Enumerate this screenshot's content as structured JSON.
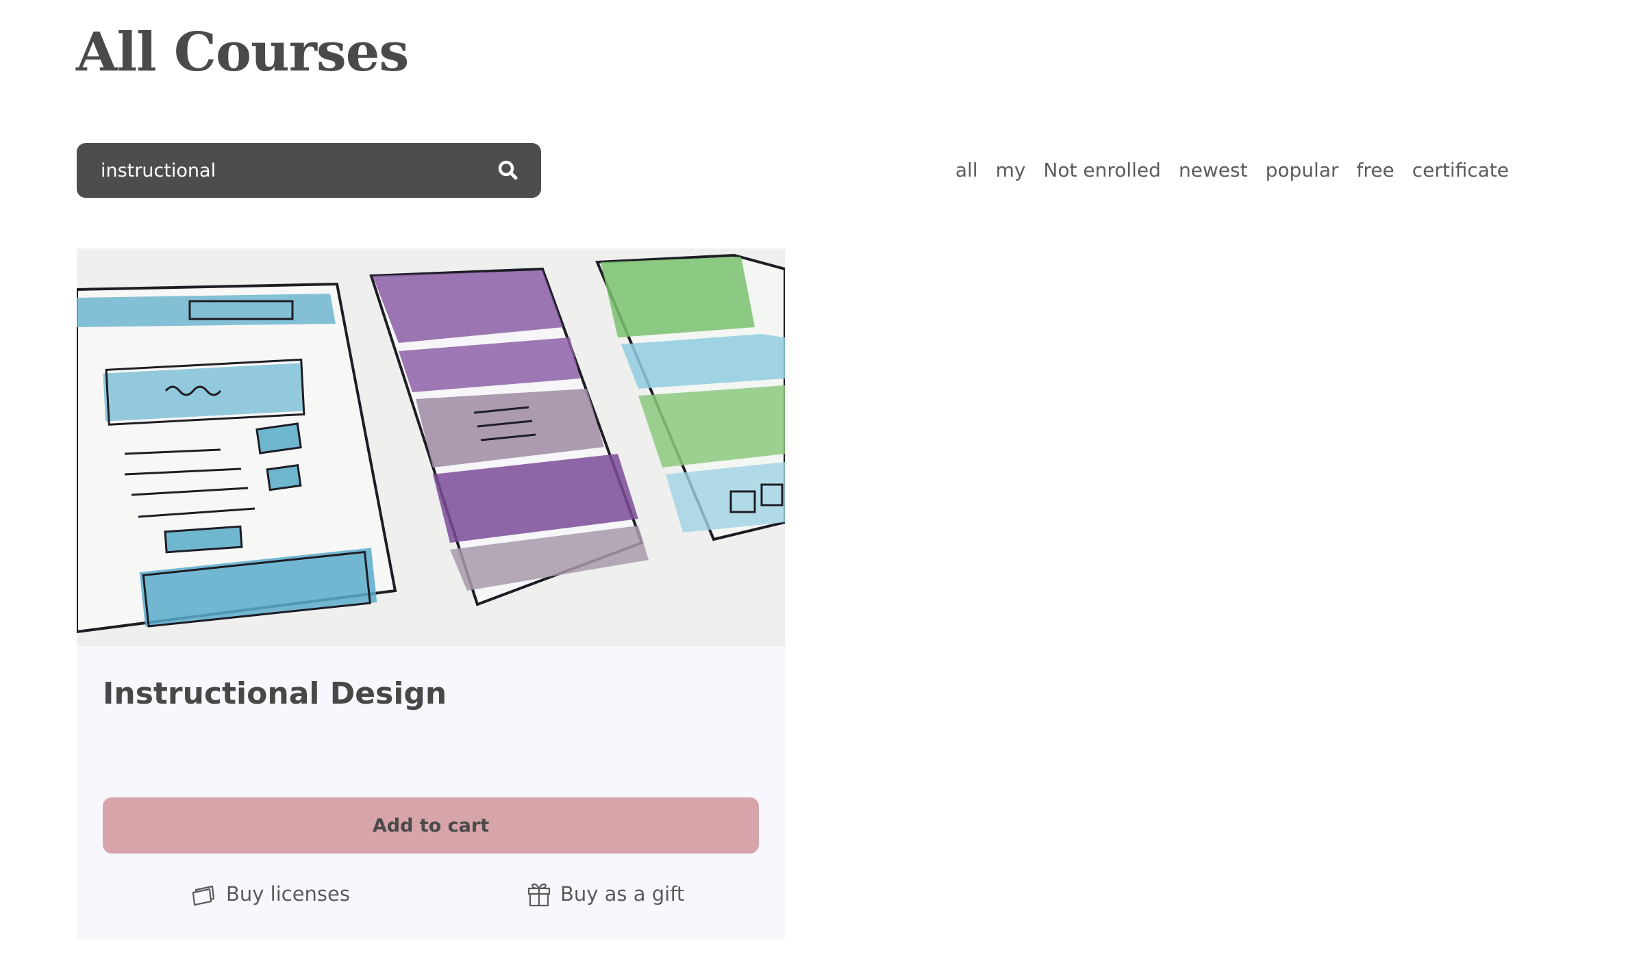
{
  "page": {
    "title": "All Courses"
  },
  "search": {
    "value": "instructional",
    "icon": "search-icon"
  },
  "filters": [
    "all",
    "my",
    "Not enrolled",
    "newest",
    "popular",
    "free",
    "certificate"
  ],
  "course": {
    "title": "Instructional Design",
    "image": "wireframe-sketch-image",
    "add_to_cart": "Add to cart",
    "buy_licenses": "Buy licenses",
    "buy_gift": "Buy as a gift"
  },
  "colors": {
    "search_bg": "#4d4d4f",
    "cart_button": "#d7a4a9",
    "card_bg": "#f8f7fd",
    "text": "#4a4a4a"
  }
}
